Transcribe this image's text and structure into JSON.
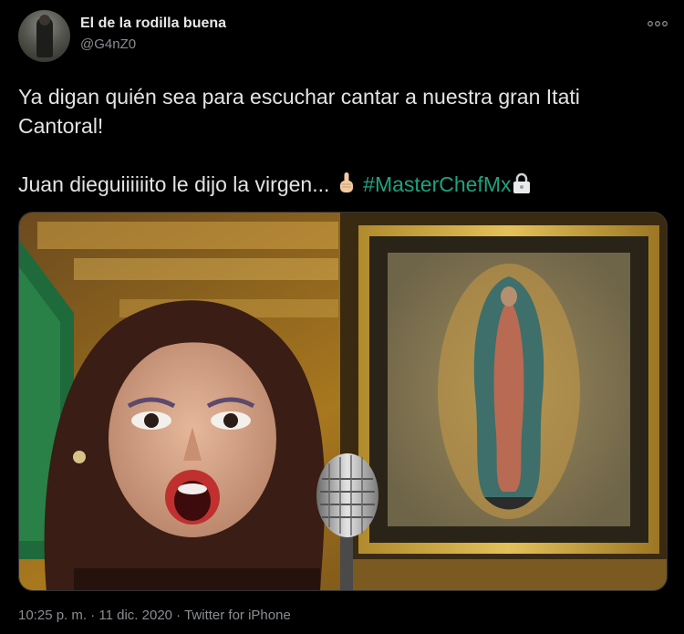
{
  "user": {
    "name": "El de la rodilla buena",
    "handle": "@G4nZ0"
  },
  "tweet": {
    "line1": "Ya digan quién sea para escuchar cantar a nuestra gran Itati Cantoral!",
    "line2": "Juan dieguiiiiiito le dijo la virgen...",
    "hashtag": "#MasterChefMx"
  },
  "meta": {
    "time": "10:25 p. m.",
    "separator": " · ",
    "date": "11 dic. 2020",
    "source": "Twitter for iPhone"
  },
  "icons": {
    "more": "more-dots-icon",
    "emoji1": "pointing-up-hand-icon",
    "emoji2": "lock-icon"
  },
  "colors": {
    "background": "#000000",
    "hashtag": "#1da37f",
    "secondary_text": "#8a8d91"
  }
}
